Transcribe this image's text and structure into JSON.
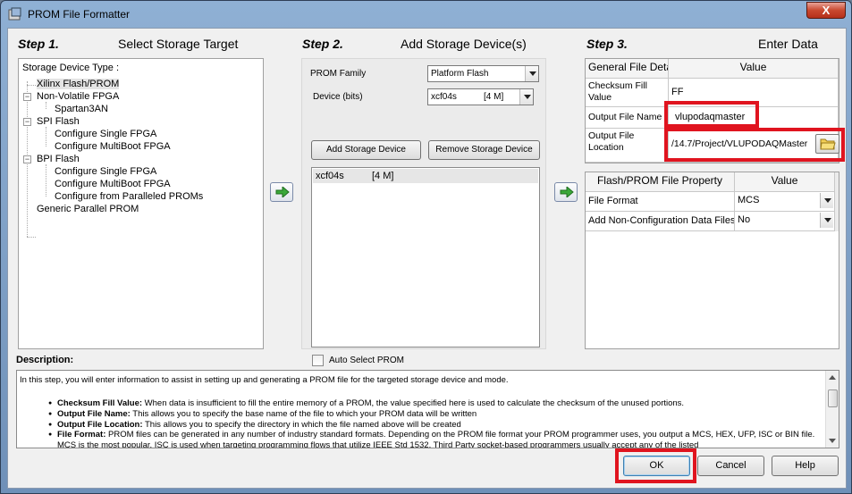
{
  "window": {
    "title": "PROM File Formatter",
    "close_label": "X"
  },
  "steps": [
    {
      "number": "Step 1.",
      "title": "Select Storage Target"
    },
    {
      "number": "Step 2.",
      "title": "Add Storage Device(s)"
    },
    {
      "number": "Step 3.",
      "title": "Enter Data"
    }
  ],
  "tree": {
    "header": "Storage Device Type :",
    "items": [
      "Xilinx Flash/PROM",
      "Non-Volatile FPGA",
      "Spartan3AN",
      "SPI Flash",
      "Configure Single FPGA",
      "Configure MultiBoot FPGA",
      "BPI Flash",
      "Configure Single FPGA",
      "Configure MultiBoot FPGA",
      "Configure from Paralleled PROMs",
      "Generic Parallel PROM"
    ],
    "selected_index": 0
  },
  "step2": {
    "prom_family_label": "PROM Family",
    "prom_family_value": "Platform Flash",
    "device_label": "Device (bits)",
    "device_value": "xcf04s",
    "device_size": "[4 M]",
    "add_label": "Add Storage Device",
    "remove_label": "Remove Storage Device",
    "devices": [
      {
        "name": "xcf04s",
        "size": "[4 M]"
      }
    ],
    "auto_select_label": "Auto Select PROM",
    "auto_select_checked": false
  },
  "step3": {
    "general": {
      "headers": [
        "General File Detai",
        "Value"
      ],
      "rows": [
        {
          "key": "Checksum Fill Value",
          "value": "FF"
        },
        {
          "key": "Output File Name",
          "value": "vlupodaqmaster"
        },
        {
          "key": "Output File Location",
          "value": "/14.7/Project/VLUPODAQMaster"
        }
      ]
    },
    "property": {
      "headers": [
        "Flash/PROM File Property",
        "Value"
      ],
      "rows": [
        {
          "key": "File Format",
          "value": "MCS"
        },
        {
          "key": "Add Non-Configuration Data Files",
          "value": "No"
        }
      ]
    }
  },
  "description": {
    "label": "Description:",
    "intro": "In this step, you will enter information to assist in setting up and generating a PROM file for the targeted storage device and mode.",
    "bullets": [
      {
        "term": "Checksum Fill Value:",
        "text": " When data is insufficient to fill the entire memory of a PROM, the value specified here is used to calculate the checksum of the unused portions."
      },
      {
        "term": "Output File Name:",
        "text": " This allows you to specify the base name of the file to which your PROM data will be written"
      },
      {
        "term": "Output File Location:",
        "text": " This allows you to specify the directory in which the file named above will be created"
      },
      {
        "term": "File Format:",
        "text": " PROM files can be generated in any number of industry standard formats. Depending on the PROM file format your PROM programmer uses, you output a MCS, HEX, UFP, ISC or BIN file. MCS is the most popular. ISC is used when targeting programming flows that utilize IEEE Std 1532. Third Party socket-based programmers usually accept any of the listed"
      }
    ]
  },
  "buttons": {
    "ok": "OK",
    "cancel": "Cancel",
    "help": "Help"
  },
  "colors": {
    "highlight": "#e0141f",
    "arrow": "#3aa83a"
  }
}
